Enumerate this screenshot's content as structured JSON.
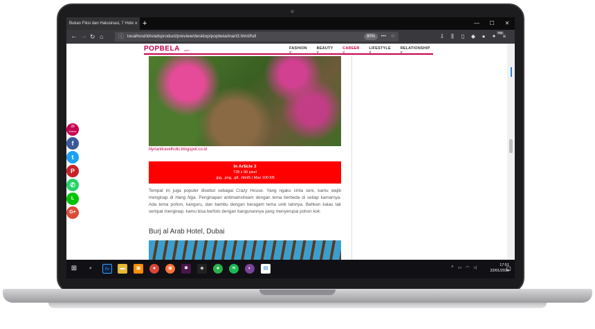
{
  "browser": {
    "tab_title": "Bukan Fiksi dan Halusinasi, 7 Hote",
    "tab_close": "×",
    "new_tab": "+",
    "win_min": "—",
    "win_max": "☐",
    "win_close": "✕",
    "url": "localhost/idn/adsproduct/preview/desktop/popbela/inart3.html/full",
    "zoom": "80%",
    "ext_badge": "765"
  },
  "site": {
    "logo": "POPBELA",
    "logo_sub": ".com",
    "nav": [
      {
        "label": "FASHION ˅"
      },
      {
        "label": "BEAUTY ˅"
      },
      {
        "label": "CAREER ˅"
      },
      {
        "label": "LIFESTYLE ˅"
      },
      {
        "label": "RELATIONSHIP ˅"
      }
    ]
  },
  "article": {
    "image_caption": "lilyrianitravelholic.blogspot.co.id",
    "ad": {
      "title": "In Article 3",
      "size": "728 x 90 pixel",
      "formats": ".jpg, .png, .gif, .html5 | Max 100 KB"
    },
    "paragraph_1a": "Tempat ini juga populer disebut sebagai ",
    "paragraph_1_em1": "Crazy House",
    "paragraph_1b": ". Yang ngaku cinta seni, kamu wajib menginap di ",
    "paragraph_1_em2": "Hang Nga",
    "paragraph_1c": ". Penginapan antimainstream dengan tema berbeda di setiap kamarnya. Ada tema pohon, kanguru, dan bambu dengan beragam tema unik lainnya. Bahkan kalau tak sempat menginap, kamu bisa berfoto dengan bangunannya yang menyerupai pohon ",
    "paragraph_1_em3": "kok",
    "paragraph_1d": ".",
    "subheading": "Burj al Arab Hotel, Dubai"
  },
  "share": {
    "count": "28",
    "count_label": "Shares",
    "buttons": [
      {
        "icon": "f",
        "color": "#3b5998"
      },
      {
        "icon": "t",
        "color": "#1da1f2"
      },
      {
        "icon": "P",
        "color": "#cb2027"
      },
      {
        "icon": "✆",
        "color": "#25d366"
      },
      {
        "icon": "L",
        "color": "#00c300"
      },
      {
        "icon": "G+",
        "color": "#dd4b39"
      }
    ]
  },
  "taskbar": {
    "time": "17:51",
    "date": "22/01/2019"
  }
}
